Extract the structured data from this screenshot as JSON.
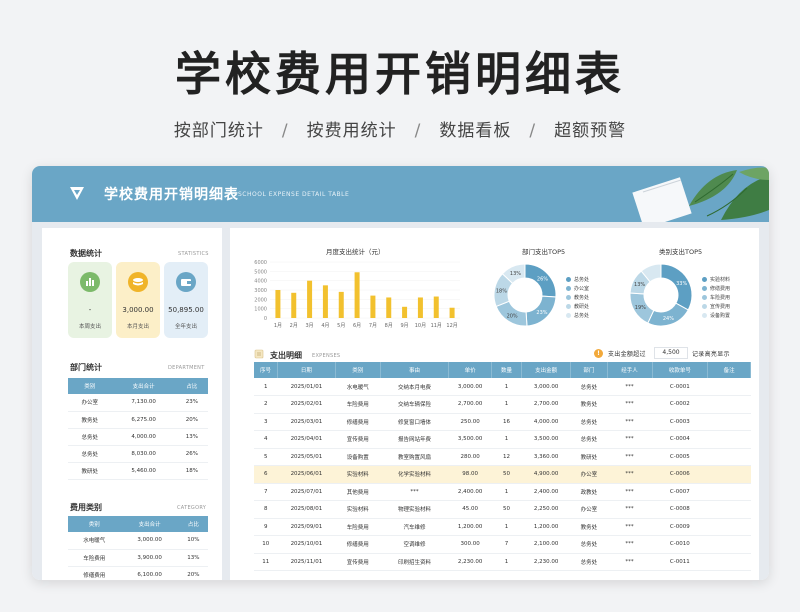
{
  "hero": {
    "title": "学校费用开销明细表"
  },
  "subtitle": {
    "items": [
      "按部门统计",
      "按费用统计",
      "数据看板",
      "超额预警"
    ],
    "separator": "/"
  },
  "app": {
    "title": "学校费用开销明细表",
    "subtitle": "SCHOOL EXPENSE DETAIL TABLE"
  },
  "colors": {
    "accent": "#6aa6c6",
    "bar": "#f2c12e",
    "highlight": "#fdf3d7",
    "warning": "#f2a93b"
  },
  "stats": {
    "title": "数据统计",
    "title_en": "STATISTICS",
    "cards": [
      {
        "icon": "chart-icon",
        "value": "-",
        "label": "本周支出"
      },
      {
        "icon": "coins-icon",
        "value": "3,000.00",
        "label": "本月支出"
      },
      {
        "icon": "wallet-icon",
        "value": "50,895.00",
        "label": "全年支出"
      }
    ]
  },
  "department": {
    "title": "部门统计",
    "title_en": "DEPARTMENT",
    "headers": [
      "类别",
      "支出合计",
      "占比"
    ],
    "rows": [
      [
        "办公室",
        "7,130.00",
        "23%"
      ],
      [
        "教务处",
        "6,275.00",
        "20%"
      ],
      [
        "总务处",
        "4,000.00",
        "13%"
      ],
      [
        "总务处",
        "8,030.00",
        "26%"
      ],
      [
        "教研处",
        "5,460.00",
        "18%"
      ]
    ]
  },
  "category": {
    "title": "费用类别",
    "title_en": "CATEGORY",
    "headers": [
      "类别",
      "支出合计",
      "占比"
    ],
    "rows": [
      [
        "水电暖气",
        "3,000.00",
        "10%"
      ],
      [
        "车险费用",
        "3,900.00",
        "13%"
      ],
      [
        "修缮费用",
        "6,100.00",
        "20%"
      ]
    ]
  },
  "monthly": {
    "title": "月度支出统计（元）",
    "chart_data": {
      "type": "bar",
      "categories": [
        "1月",
        "2月",
        "3月",
        "4月",
        "5月",
        "6月",
        "7月",
        "8月",
        "9月",
        "10月",
        "11月",
        "12月"
      ],
      "values": [
        3000,
        2700,
        4000,
        3500,
        2800,
        4900,
        2400,
        2200,
        1200,
        2200,
        2300,
        1100
      ],
      "yticks": [
        "6000",
        "5000",
        "4000",
        "3000",
        "2000",
        "1000",
        "0"
      ],
      "ylim": [
        0,
        6000
      ]
    }
  },
  "dept_top": {
    "title": "部门支出TOP5",
    "chart_data": {
      "type": "pie",
      "labels": [
        "总务处",
        "办公室",
        "教务处",
        "教研处",
        "总务处"
      ],
      "values": [
        26,
        23,
        20,
        18,
        13
      ],
      "percent_labels": [
        "26%",
        "23%",
        "20%",
        "18%",
        "13%"
      ],
      "colors": [
        "#5d9fc3",
        "#7db3d0",
        "#9dc6dc",
        "#bcd8e7",
        "#d8e8f1"
      ]
    }
  },
  "cat_top": {
    "title": "类别支出TOP5",
    "chart_data": {
      "type": "pie",
      "labels": [
        "实验材料",
        "修缮费用",
        "车险费用",
        "宣传费用",
        "设备购置"
      ],
      "values": [
        33,
        24,
        19,
        13,
        11
      ],
      "percent_labels": [
        "33%",
        "24%",
        "19%",
        "13%",
        ""
      ],
      "colors": [
        "#5d9fc3",
        "#7db3d0",
        "#9dc6dc",
        "#bcd8e7",
        "#d8e8f1"
      ]
    }
  },
  "expenses": {
    "title": "支出明细",
    "title_en": "EXPENSES",
    "threshold_label": "支出金额超过",
    "threshold_value": "4,500",
    "threshold_note": "记录高亮显示",
    "headers": [
      "序号",
      "日期",
      "类别",
      "事由",
      "单价",
      "数量",
      "支出金额",
      "部门",
      "经手人",
      "收款单号",
      "备注"
    ],
    "rows": [
      [
        "1",
        "2025/01/01",
        "水电暖气",
        "交纳本月电费",
        "3,000.00",
        "1",
        "3,000.00",
        "总务处",
        "***",
        "C-0001",
        ""
      ],
      [
        "2",
        "2025/02/01",
        "车险费用",
        "交纳车辆保险",
        "2,700.00",
        "1",
        "2,700.00",
        "教务处",
        "***",
        "C-0002",
        ""
      ],
      [
        "3",
        "2025/03/01",
        "修缮费用",
        "修复窗口墙体",
        "250.00",
        "16",
        "4,000.00",
        "总务处",
        "***",
        "C-0003",
        ""
      ],
      [
        "4",
        "2025/04/01",
        "宣传费用",
        "报告网站年费",
        "3,500.00",
        "1",
        "3,500.00",
        "总务处",
        "***",
        "C-0004",
        ""
      ],
      [
        "5",
        "2025/05/01",
        "设备购置",
        "教室购置风扇",
        "280.00",
        "12",
        "3,360.00",
        "教研处",
        "***",
        "C-0005",
        ""
      ],
      [
        "6",
        "2025/06/01",
        "实验材料",
        "化学实验材料",
        "98.00",
        "50",
        "4,900.00",
        "办公室",
        "***",
        "C-0006",
        ""
      ],
      [
        "7",
        "2025/07/01",
        "其他费用",
        "***",
        "2,400.00",
        "1",
        "2,400.00",
        "政教处",
        "***",
        "C-0007",
        ""
      ],
      [
        "8",
        "2025/08/01",
        "实验材料",
        "物理实验材料",
        "45.00",
        "50",
        "2,250.00",
        "办公室",
        "***",
        "C-0008",
        ""
      ],
      [
        "9",
        "2025/09/01",
        "车险费用",
        "汽车维修",
        "1,200.00",
        "1",
        "1,200.00",
        "教务处",
        "***",
        "C-0009",
        ""
      ],
      [
        "10",
        "2025/10/01",
        "修缮费用",
        "空调维修",
        "300.00",
        "7",
        "2,100.00",
        "总务处",
        "***",
        "C-0010",
        ""
      ],
      [
        "11",
        "2025/11/01",
        "宣传费用",
        "印刷招生资料",
        "2,230.00",
        "1",
        "2,230.00",
        "总务处",
        "***",
        "C-0011",
        ""
      ]
    ]
  }
}
